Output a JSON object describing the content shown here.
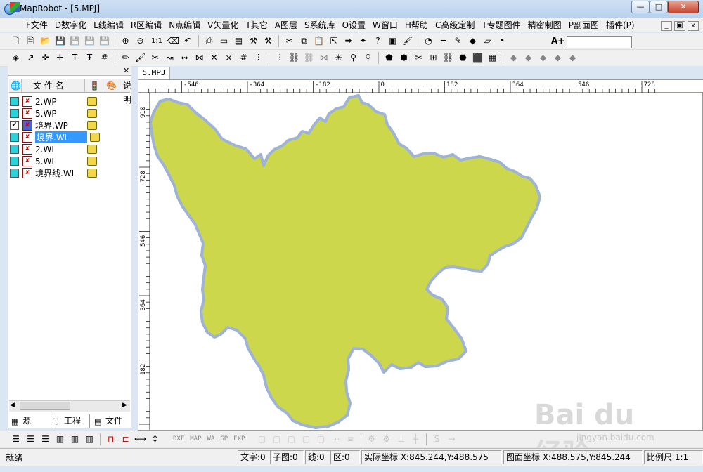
{
  "window": {
    "title": "MapRobot - [5.MPJ]",
    "minimize_label": "—",
    "maximize_label": "□",
    "close_label": "✕",
    "mdi_minimize": "_",
    "mdi_restore": "▣",
    "mdi_close": "x"
  },
  "menu": {
    "items": [
      "F文件",
      "D数字化",
      "L线编辑",
      "R区编辑",
      "N点编辑",
      "V矢量化",
      "T其它",
      "A图层",
      "S系统库",
      "O设置",
      "W窗口",
      "H帮助",
      "C高级定制",
      "T专题图件",
      "精密制图",
      "P剖面图",
      "插件(P)"
    ]
  },
  "toolbar1": {
    "icons": [
      "new-icon",
      "open-doc-icon",
      "folder-icon",
      "save-icon",
      "save-gray-icon",
      "save-gray-icon",
      "save-gray-icon",
      "zoom-in-icon",
      "zoom-out-icon",
      "one-to-one-icon",
      "erase-icon",
      "undo-icon",
      "print-icon",
      "layer-icon",
      "layer-green-icon",
      "tools-icon",
      "hammer-icon",
      "cut-icon",
      "copy-icon",
      "paste-icon",
      "file-pointer-icon",
      "arrow-right-icon",
      "node-icon",
      "help-icon",
      "bin-icon",
      "brush-icon",
      "measure-icon",
      "line-icon",
      "pen-icon",
      "fill-icon",
      "eraser-icon",
      "color-point-icon"
    ],
    "zoom_label": "1:1",
    "font_size_label": "A+"
  },
  "toolbar2": {
    "icons": [
      "point-edit-icon",
      "line-edit-icon",
      "node-move-icon",
      "node-add-icon",
      "text-icon",
      "text-edit-icon",
      "grid-icon",
      "pencil-icon",
      "brush-icon",
      "cut-icon",
      "line-move-icon",
      "line-copy-icon",
      "vertex-icon",
      "cross-icon",
      "intersect-icon",
      "grid-icon",
      "split-icon",
      "split-gray-icon",
      "link-icon",
      "link-gray-icon",
      "vertex-gray-icon",
      "spread-icon",
      "pin-icon",
      "pin-cross-icon",
      "area-icon",
      "area-fill-icon",
      "area-cut-icon",
      "area-join-icon",
      "area-link-icon",
      "area-node-icon",
      "area-red-icon",
      "area-grid-icon",
      "area-gray-icon",
      "area-gray-icon",
      "area-gray-icon",
      "area-gray-icon",
      "area-gray-icon"
    ]
  },
  "panel": {
    "close_label": "✕",
    "col_name": "文 件 名",
    "col_desc": "说明",
    "files": [
      {
        "name": "2.WP",
        "type": "WP",
        "checked": false,
        "selected": false
      },
      {
        "name": "5.WP",
        "type": "WP",
        "checked": false,
        "selected": false
      },
      {
        "name": "境界.WP",
        "type": "WP",
        "checked": true,
        "selected": false
      },
      {
        "name": "境界.WL",
        "type": "WL",
        "checked": false,
        "selected": true
      },
      {
        "name": "2.WL",
        "type": "WL",
        "checked": false,
        "selected": false
      },
      {
        "name": "5.WL",
        "type": "WL",
        "checked": false,
        "selected": false
      },
      {
        "name": "境界线.WL",
        "type": "WL",
        "checked": false,
        "selected": false
      }
    ],
    "tabs": [
      "源",
      "工程",
      "文件"
    ]
  },
  "document": {
    "tab_label": "5.MPJ",
    "ruler_x": [
      "-546",
      "-364",
      "-182",
      "0",
      "182",
      "364",
      "546",
      "728"
    ],
    "ruler_y": [
      "910",
      "728",
      "546",
      "364",
      "182"
    ],
    "map_fill": "#cdd74b",
    "map_border": "#9fb3d6"
  },
  "bottom_toolbar": {
    "labels": [
      "DXF",
      "MAP",
      "WA",
      "GP",
      "EXP"
    ]
  },
  "status": {
    "ready": "就绪",
    "text_count": "文字:0",
    "subpic_count": "子图:0",
    "line_count": "线:0",
    "area_count": "区:0",
    "actual_coord": "实际坐标 X:845.244,Y:488.575",
    "map_coord": "图面坐标 X:488.575,Y:845.244",
    "scale": "比例尺 1:1"
  },
  "watermark": {
    "text": "Bai du 经验",
    "sub": "jingyan.baidu.com"
  }
}
